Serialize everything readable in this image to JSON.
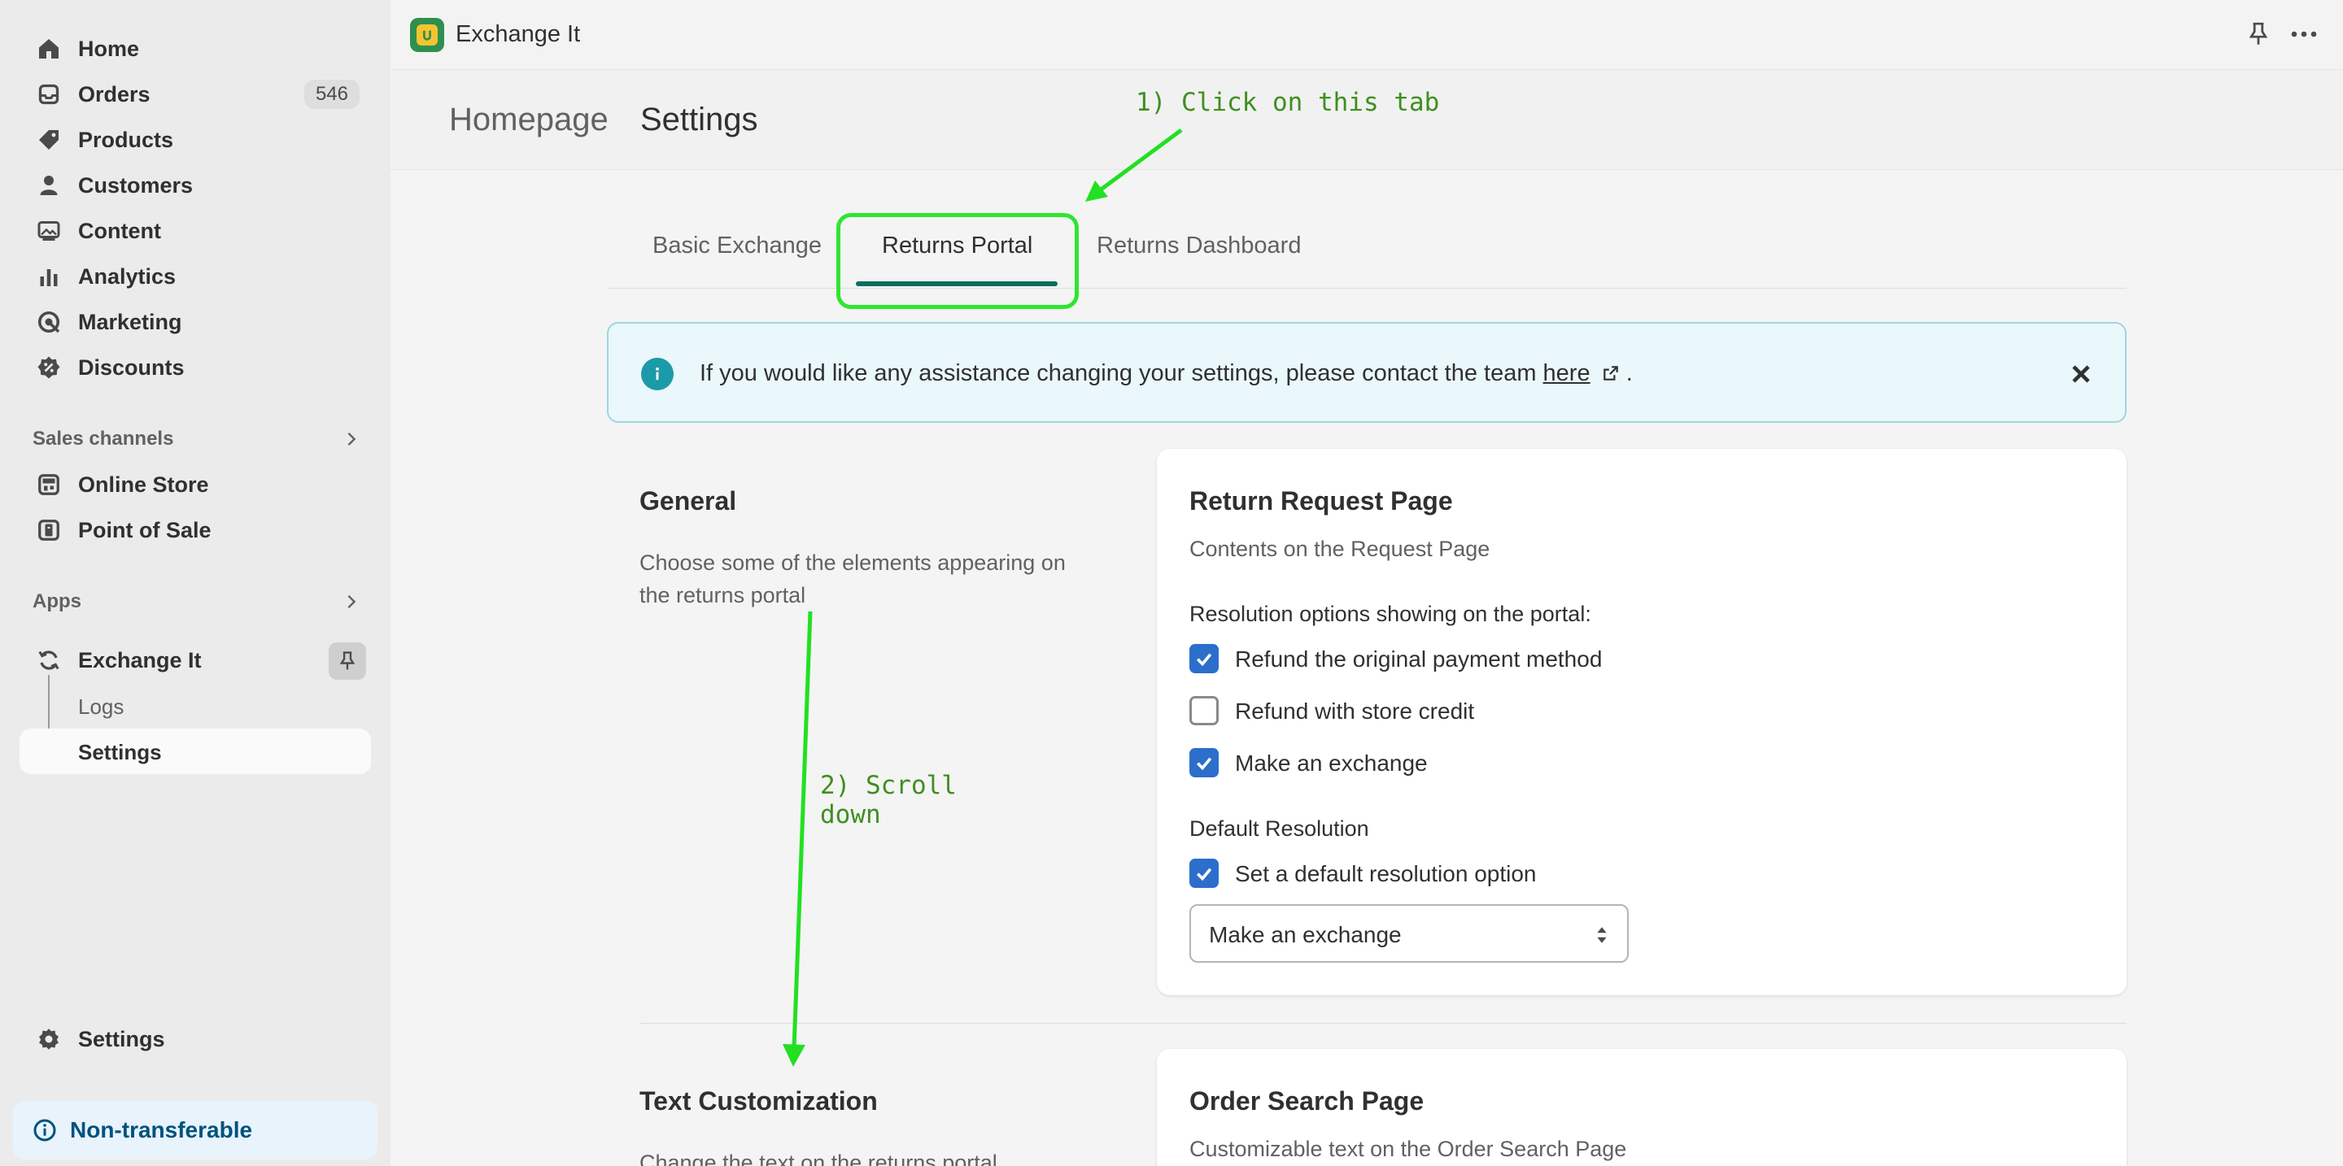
{
  "sidebar": {
    "nav": [
      {
        "label": "Home",
        "icon": "home-icon"
      },
      {
        "label": "Orders",
        "icon": "orders-icon",
        "badge": "546"
      },
      {
        "label": "Products",
        "icon": "tag-icon"
      },
      {
        "label": "Customers",
        "icon": "person-icon"
      },
      {
        "label": "Content",
        "icon": "image-icon"
      },
      {
        "label": "Analytics",
        "icon": "bar-chart-icon"
      },
      {
        "label": "Marketing",
        "icon": "target-icon"
      },
      {
        "label": "Discounts",
        "icon": "discount-icon"
      }
    ],
    "sales_channels_label": "Sales channels",
    "channels": [
      {
        "label": "Online Store",
        "icon": "store-icon"
      },
      {
        "label": "Point of Sale",
        "icon": "pos-icon"
      }
    ],
    "apps_label": "Apps",
    "app": {
      "label": "Exchange It",
      "icon": "sync-icon"
    },
    "app_sub": [
      {
        "label": "Logs"
      },
      {
        "label": "Settings"
      }
    ],
    "settings_label": "Settings",
    "non_transferable_label": "Non-transferable"
  },
  "topbar": {
    "app_title": "Exchange It"
  },
  "header": {
    "breadcrumb_home": "Homepage",
    "title": "Settings"
  },
  "tabs": [
    {
      "label": "Basic Exchange",
      "active": false
    },
    {
      "label": "Returns Portal",
      "active": true
    },
    {
      "label": "Returns Dashboard",
      "active": false
    }
  ],
  "banner": {
    "text_before": "If you would like any assistance changing your settings, please contact the team ",
    "link_text": "here",
    "text_after": " ."
  },
  "general": {
    "title": "General",
    "description": "Choose some of the elements appearing on the returns portal"
  },
  "return_request_card": {
    "title": "Return Request Page",
    "subtitle": "Contents on the Request Page",
    "resolution_label": "Resolution options showing on the portal:",
    "options": [
      {
        "label": "Refund the original payment method",
        "checked": true
      },
      {
        "label": "Refund with store credit",
        "checked": false
      },
      {
        "label": "Make an exchange",
        "checked": true
      }
    ],
    "default_resolution_label": "Default Resolution",
    "default_checkbox": {
      "label": "Set a default resolution option",
      "checked": true
    },
    "select_value": "Make an exchange"
  },
  "text_customization": {
    "title": "Text Customization",
    "description": "Change the text on the returns portal"
  },
  "order_search_card": {
    "title": "Order Search Page",
    "subtitle": "Customizable text on the Order Search Page"
  },
  "annotations": {
    "step1": "1) Click on this tab",
    "step2_line1": "2) Scroll",
    "step2_line2": "down",
    "color": "#22e022"
  },
  "colors": {
    "accent": "#0b6e5e",
    "checkbox": "#2c6ecb",
    "banner_bg": "#eaf7fb",
    "non_transferable_text": "#00527c"
  }
}
